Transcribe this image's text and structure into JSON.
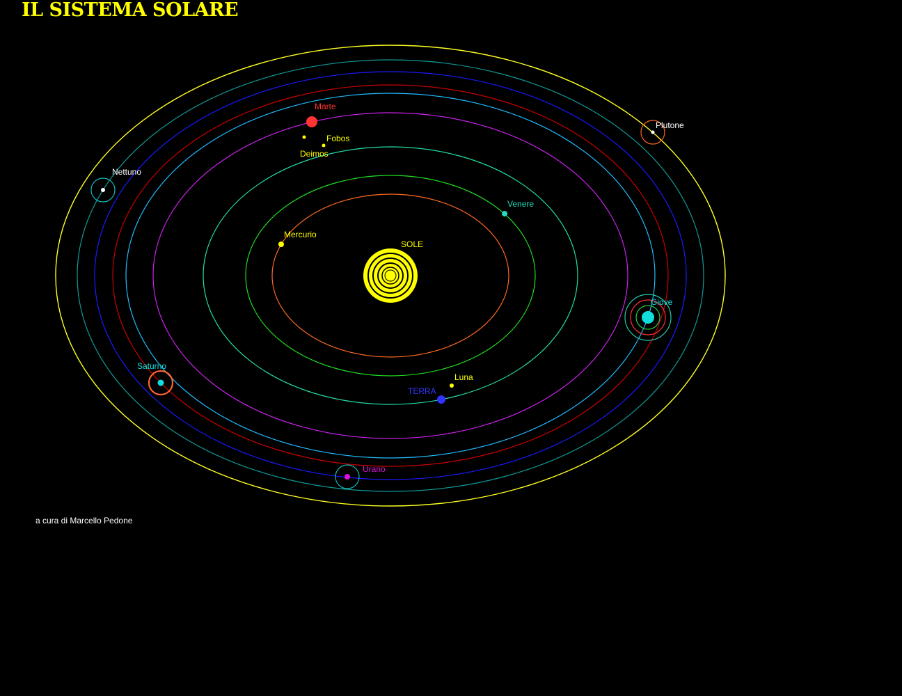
{
  "title": "IL SISTEMA SOLARE",
  "credit": "a cura di Marcello Pedone",
  "colors": {
    "background": "#000000",
    "title": "#ffff00",
    "credit": "#ffffff"
  },
  "sun": {
    "label": "SOLE",
    "color": "#ffff00",
    "label_color": "#ffff00"
  },
  "orbits": [
    {
      "name": "orbit-mercurio",
      "color": "#ff6a1f"
    },
    {
      "name": "orbit-venere",
      "color": "#22dd22"
    },
    {
      "name": "orbit-terra",
      "color": "#22ddaa"
    },
    {
      "name": "orbit-marte",
      "color": "#cc22ee"
    },
    {
      "name": "orbit-giove",
      "color": "#22bbff"
    },
    {
      "name": "orbit-saturno",
      "color": "#cc0000"
    },
    {
      "name": "orbit-urano",
      "color": "#1a1aff"
    },
    {
      "name": "orbit-nettuno",
      "color": "#119999"
    },
    {
      "name": "orbit-plutone",
      "color": "#ffff22"
    }
  ],
  "bodies": {
    "mercurio": {
      "label": "Mercurio",
      "color": "#ffff00",
      "label_color": "#ffff00"
    },
    "venere": {
      "label": "Venere",
      "color": "#22ddbb",
      "label_color": "#22ddbb"
    },
    "terra": {
      "label": "TERRA",
      "color": "#3333ff",
      "label_color": "#3333ff"
    },
    "luna": {
      "label": "Luna",
      "color": "#ffff00",
      "label_color": "#ffff00"
    },
    "marte": {
      "label": "Marte",
      "color": "#ff3333",
      "label_color": "#ff3333"
    },
    "fobos": {
      "label": "Fobos",
      "color": "#ffff00",
      "label_color": "#ffff00"
    },
    "deimos": {
      "label": "Deimos",
      "color": "#ffff00",
      "label_color": "#ffff00"
    },
    "giove": {
      "label": "Giove",
      "color": "#11dddd",
      "label_color": "#11dddd"
    },
    "saturno": {
      "label": "Saturno",
      "color": "#11dddd",
      "label_color": "#11dddd",
      "ring_color": "#ff6633"
    },
    "urano": {
      "label": "Urano",
      "color": "#dd11dd",
      "label_color": "#dd11dd",
      "ring_color": "#11bbbb"
    },
    "nettuno": {
      "label": "Nettuno",
      "color": "#ffffff",
      "label_color": "#ffffff",
      "ring_color": "#11bbbb"
    },
    "plutone": {
      "label": "Plutone",
      "color": "#ffffff",
      "label_color": "#ffffff",
      "ring_color": "#ff6622"
    }
  }
}
